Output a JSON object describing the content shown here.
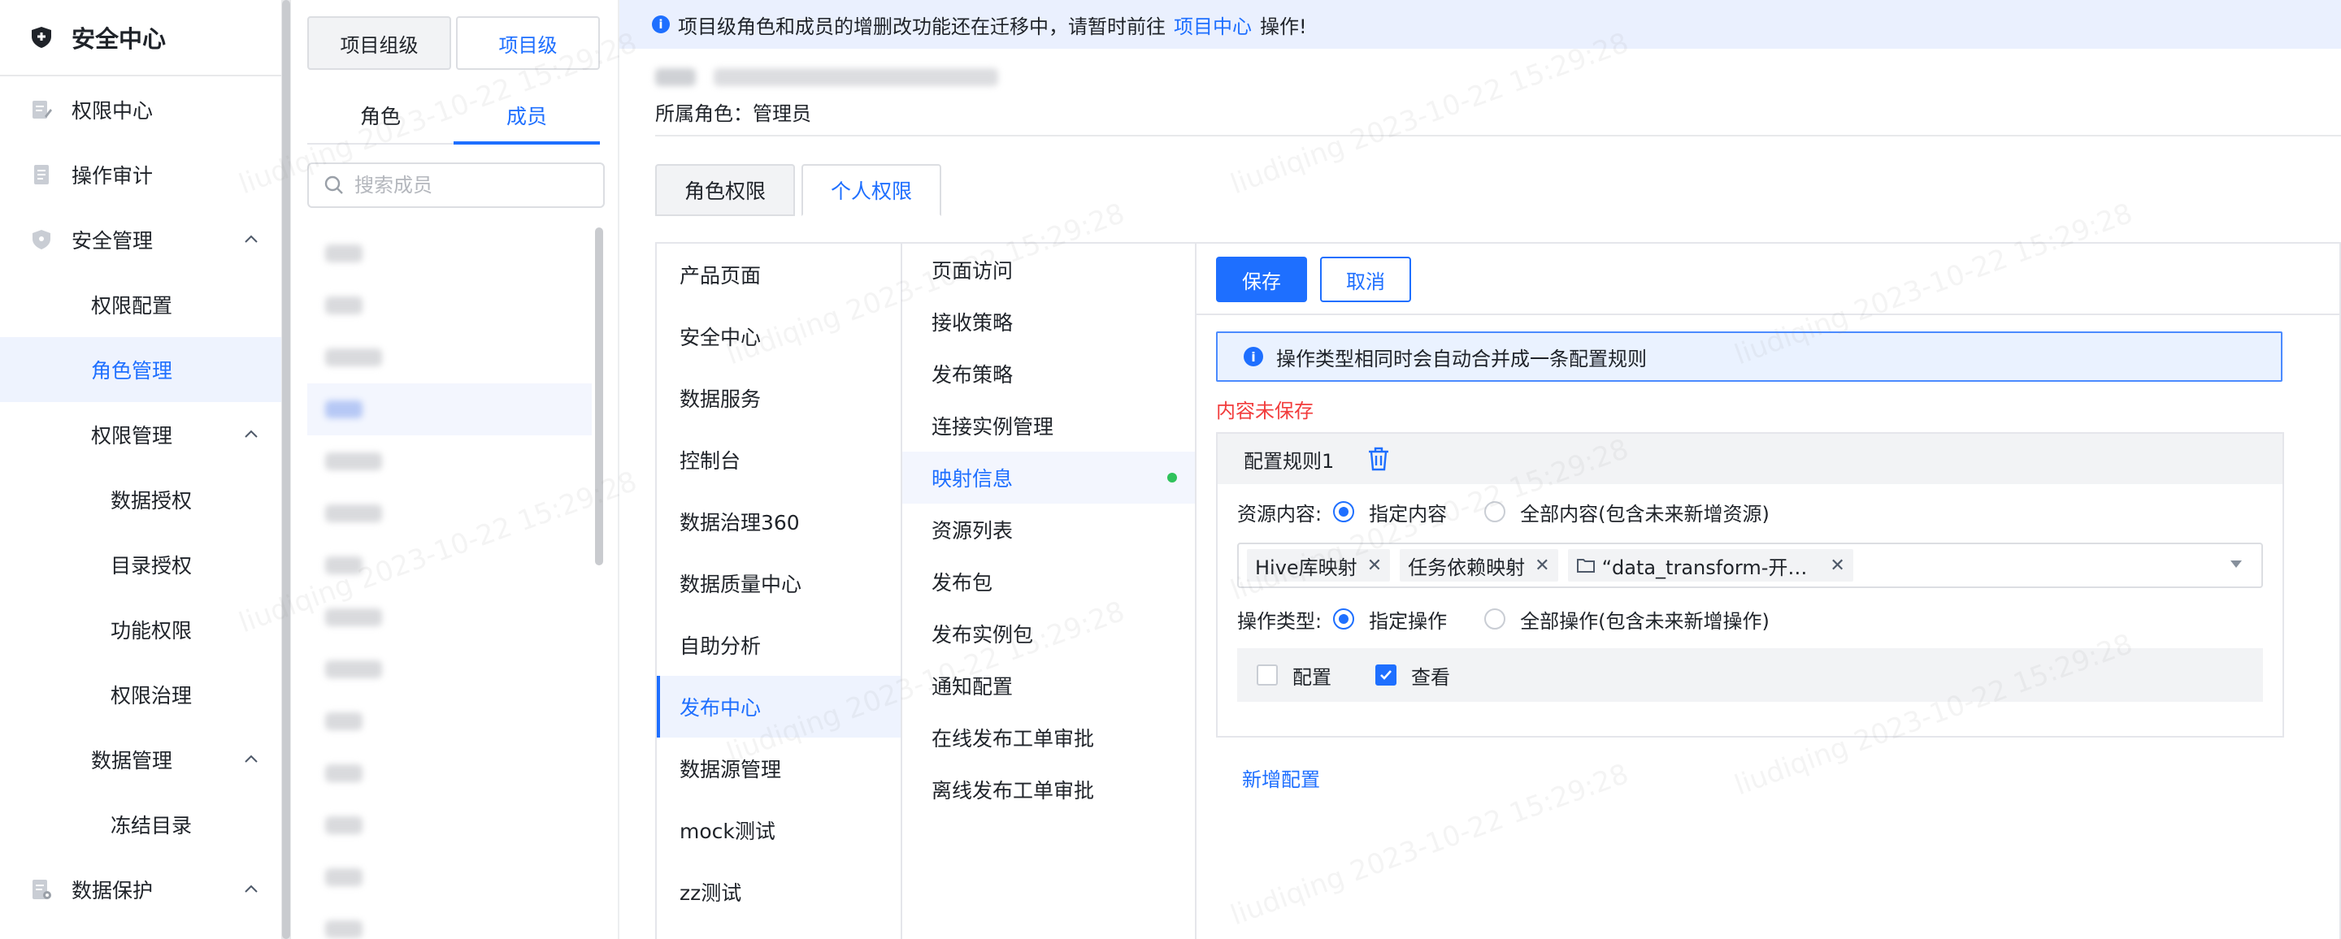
{
  "nav": {
    "title": "安全中心",
    "items": [
      {
        "label": "权限中心"
      },
      {
        "label": "操作审计"
      },
      {
        "label": "安全管理"
      },
      {
        "label": "权限配置"
      },
      {
        "label": "角色管理"
      },
      {
        "label": "权限管理"
      },
      {
        "label": "数据授权"
      },
      {
        "label": "目录授权"
      },
      {
        "label": "功能权限"
      },
      {
        "label": "权限治理"
      },
      {
        "label": "数据管理"
      },
      {
        "label": "冻结目录"
      },
      {
        "label": "数据保护"
      }
    ]
  },
  "member_panel": {
    "seg": [
      "项目组级",
      "项目级"
    ],
    "tabs": [
      "角色",
      "成员"
    ],
    "search_placeholder": "搜索成员"
  },
  "main": {
    "banner": {
      "prefix": "项目级角色和成员的增删改功能还在迁移中，请暂时前往",
      "link": "项目中心",
      "suffix": "操作!"
    },
    "role_line": "所属角色：管理员",
    "tabs": [
      "角色权限",
      "个人权限"
    ],
    "col1": [
      "产品页面",
      "安全中心",
      "数据服务",
      "控制台",
      "数据治理360",
      "数据质量中心",
      "自助分析",
      "发布中心",
      "数据源管理",
      "mock测试",
      "zz测试"
    ],
    "col2": [
      "页面访问",
      "接收策略",
      "发布策略",
      "连接实例管理",
      "映射信息",
      "资源列表",
      "发布包",
      "发布实例包",
      "通知配置",
      "在线发布工单审批",
      "离线发布工单审批"
    ],
    "save": "保存",
    "cancel": "取消",
    "alert": "操作类型相同时会自动合并成一条配置规则",
    "unsaved": "内容未保存",
    "rule": {
      "title": "配置规则1",
      "resource_label": "资源内容:",
      "resource_opt1": "指定内容",
      "resource_opt2": "全部内容(包含未来新增资源)",
      "chips": [
        "Hive库映射",
        "任务依赖映射",
        "“data_transform-开…"
      ],
      "op_label": "操作类型:",
      "op_opt1": "指定操作",
      "op_opt2": "全部操作(包含未来新增操作)",
      "cb1": "配置",
      "cb2": "查看"
    },
    "add": "新增配置"
  },
  "watermark": "liudiqing 2023-10-22 15:29:28",
  "colors": {
    "accent": "#1e6fff",
    "danger": "#f23c3c",
    "success": "#2fc25b"
  }
}
